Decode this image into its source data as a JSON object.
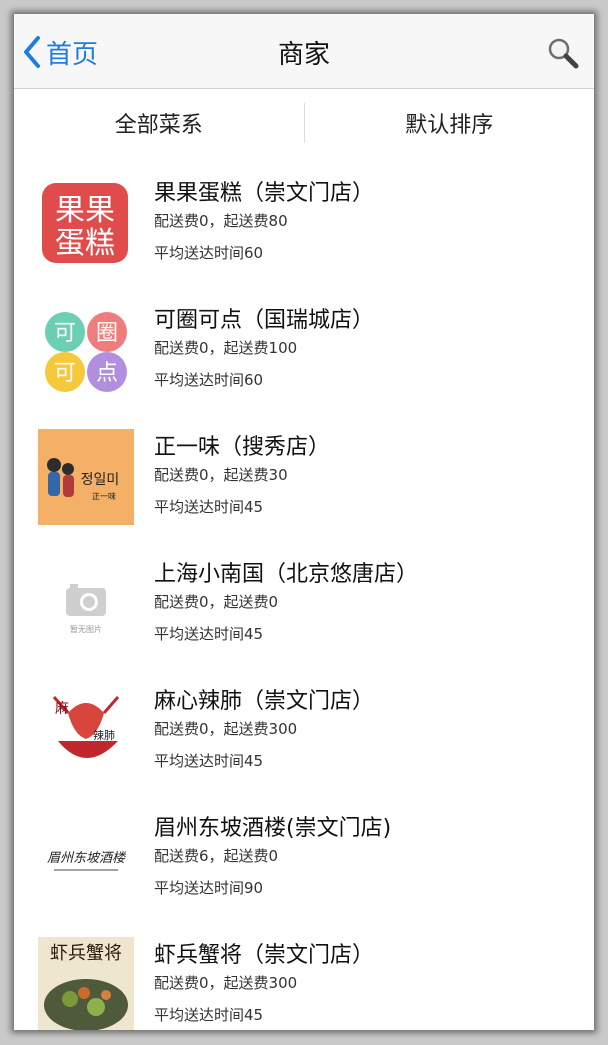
{
  "nav": {
    "back_label": "首页",
    "title": "商家"
  },
  "filters": {
    "cuisine": "全部菜系",
    "sort": "默认排序"
  },
  "shops": [
    {
      "name": "果果蛋糕（崇文门店）",
      "fee": "配送费0，起送费80",
      "time": "平均送达时间60",
      "logo_text": "果果蛋糕",
      "logo": "cake-logo"
    },
    {
      "name": "可圈可点（国瑞城店）",
      "fee": "配送费0，起送费100",
      "time": "平均送达时间60",
      "logo_text": "可圈可点",
      "logo": "dots-logo"
    },
    {
      "name": "正一味（搜秀店）",
      "fee": "配送费0，起送费30",
      "time": "平均送达时间45",
      "logo_text": "정일미 正一味",
      "logo": "restaurant-logo"
    },
    {
      "name": "上海小南国（北京悠唐店）",
      "fee": "配送费0，起送费0",
      "time": "平均送达时间45",
      "logo_text": "暂无图片",
      "logo": "camera-placeholder-icon"
    },
    {
      "name": "麻心辣肺（崇文门店）",
      "fee": "配送费0，起送费300",
      "time": "平均送达时间45",
      "logo_text": "麻心辣肺",
      "logo": "lobster-logo"
    },
    {
      "name": "眉州东坡酒楼(崇文门店)",
      "fee": "配送费6，起送费0",
      "time": "平均送达时间90",
      "logo_text": "眉州东坡酒楼",
      "logo": "calligraphy-logo"
    },
    {
      "name": "虾兵蟹将（崇文门店）",
      "fee": "配送费0，起送费300",
      "time": "平均送达时间45",
      "logo_text": "虾兵蟹将",
      "logo": "seafood-dish-photo"
    }
  ]
}
